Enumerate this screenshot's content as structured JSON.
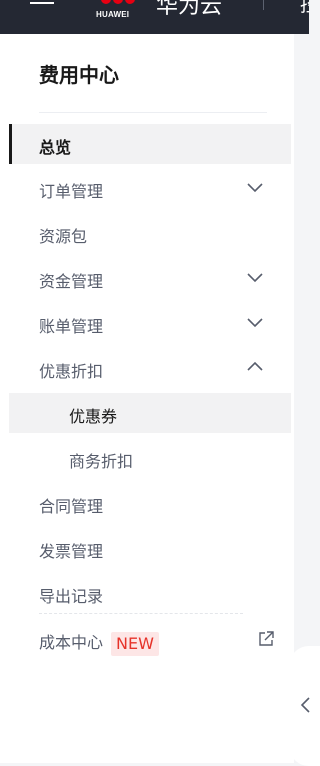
{
  "topbar": {
    "logo_text": "HUAWEI",
    "brand_name": "华为云",
    "partial_text": "控"
  },
  "sidebar": {
    "title": "费用中心",
    "items": [
      {
        "label": "总览",
        "chevron": "none",
        "state": "active"
      },
      {
        "label": "订单管理",
        "chevron": "down"
      },
      {
        "label": "资源包",
        "chevron": "none"
      },
      {
        "label": "资金管理",
        "chevron": "down"
      },
      {
        "label": "账单管理",
        "chevron": "down"
      },
      {
        "label": "优惠折扣",
        "chevron": "up",
        "expanded": true
      },
      {
        "label": "优惠券",
        "level": 2,
        "state": "selected"
      },
      {
        "label": "商务折扣",
        "level": 2
      },
      {
        "label": "合同管理",
        "chevron": "none"
      },
      {
        "label": "发票管理",
        "chevron": "none"
      },
      {
        "label": "导出记录",
        "chevron": "none"
      },
      {
        "label": "成本中心",
        "badge": "NEW",
        "icon": "external-link-icon"
      }
    ]
  },
  "colors": {
    "topbar_bg": "#242833",
    "badge_text": "#e6332a",
    "badge_bg": "#fde6e6",
    "active_bg": "#f2f2f3"
  }
}
